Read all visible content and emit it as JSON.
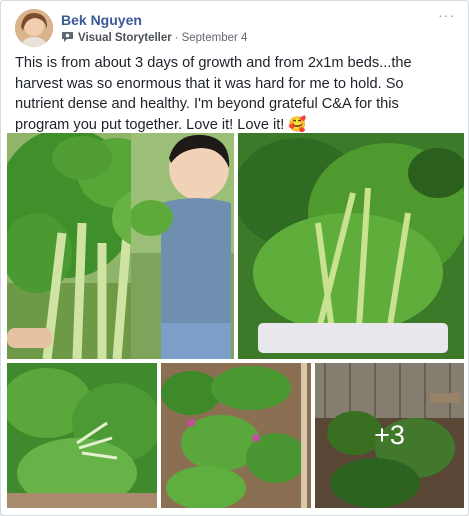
{
  "post": {
    "author": "Bek Nguyen",
    "badge_label": "Visual Storyteller",
    "date": "September 4",
    "more_label": "···",
    "text": "This is from about 3 days of growth and from 2x1m beds...the harvest was so enormous that it was hard for me to hold. So nutrient dense and healthy. I'm beyond grateful C&A for this program you put together. Love it! Love it! 🥰"
  },
  "photos": {
    "more_count_label": "+3"
  },
  "icons": {
    "badge": "badge-icon",
    "avatar": "avatar",
    "more": "more-options-icon"
  },
  "colors": {
    "author_link": "#3b5998",
    "meta_text": "#616770",
    "body_text": "#1d2129",
    "leaf_green": "#4e9a2f"
  }
}
